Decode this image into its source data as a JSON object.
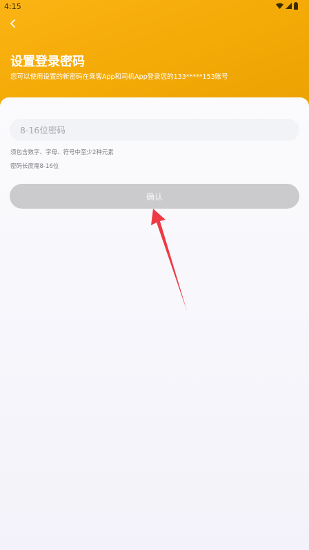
{
  "status_bar": {
    "time": "4:15",
    "icons": [
      "wifi-icon",
      "signal-icon",
      "battery-icon"
    ]
  },
  "nav": {
    "back_icon": "chevron-left-icon"
  },
  "header": {
    "title": "设置登录密码",
    "subtitle": "您可以使用设置的新密码在乘客App和司机App登录您的133*****153账号"
  },
  "form": {
    "password": {
      "value": "",
      "placeholder": "8-16位密码"
    },
    "hints": [
      "须包含数字、字母、符号中至少2种元素",
      "密码长度需8-16位"
    ],
    "confirm_label": "确认"
  },
  "colors": {
    "header_gradient_start": "#fbb414",
    "header_gradient_end": "#eaa203",
    "confirm_disabled": "#cbcbcd",
    "annotation_arrow": "#ee3a44"
  }
}
